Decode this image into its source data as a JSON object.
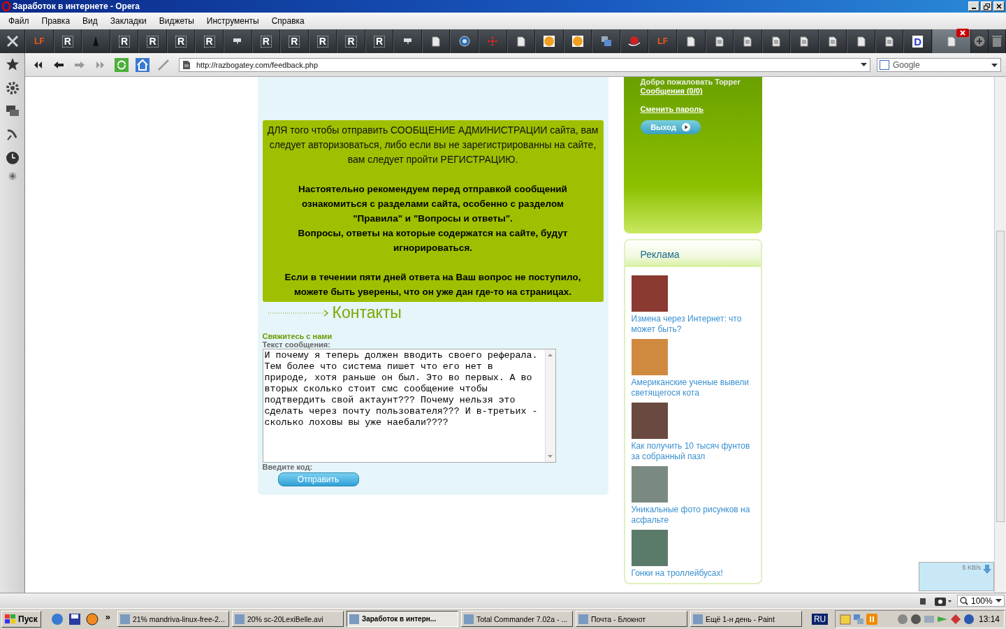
{
  "window": {
    "title": "Заработок в интернете - Opera"
  },
  "menu": [
    "Файл",
    "Правка",
    "Вид",
    "Закладки",
    "Виджеты",
    "Инструменты",
    "Справка"
  ],
  "tabs": [
    {
      "kind": "logo",
      "label": "LF",
      "selected": false
    },
    {
      "kind": "letter",
      "label": "R",
      "selected": false
    },
    {
      "kind": "dark",
      "selected": false
    },
    {
      "kind": "letter",
      "label": "R",
      "selected": false
    },
    {
      "kind": "letter",
      "label": "R",
      "selected": false
    },
    {
      "kind": "letter",
      "label": "R",
      "selected": false
    },
    {
      "kind": "letter",
      "label": "R",
      "selected": false
    },
    {
      "kind": "puzzle",
      "selected": false
    },
    {
      "kind": "letter",
      "label": "R",
      "selected": false
    },
    {
      "kind": "letter",
      "label": "R",
      "selected": false
    },
    {
      "kind": "letter",
      "label": "R",
      "selected": false
    },
    {
      "kind": "letter",
      "label": "R",
      "selected": false
    },
    {
      "kind": "letter",
      "label": "R",
      "selected": false
    },
    {
      "kind": "puzzle",
      "selected": false
    },
    {
      "kind": "doc",
      "selected": false
    },
    {
      "kind": "circle",
      "selected": false
    },
    {
      "kind": "burst",
      "selected": false
    },
    {
      "kind": "doc",
      "selected": false
    },
    {
      "kind": "orange",
      "selected": false
    },
    {
      "kind": "orange",
      "selected": false
    },
    {
      "kind": "windows",
      "selected": false
    },
    {
      "kind": "globe",
      "selected": false
    },
    {
      "kind": "logo",
      "label": "LF",
      "selected": false
    },
    {
      "kind": "doc",
      "selected": false
    },
    {
      "kind": "lines",
      "selected": false
    },
    {
      "kind": "lines",
      "selected": false
    },
    {
      "kind": "lines",
      "selected": false
    },
    {
      "kind": "lines",
      "selected": false
    },
    {
      "kind": "lines",
      "selected": false
    },
    {
      "kind": "doc",
      "selected": false
    },
    {
      "kind": "lines",
      "selected": false
    },
    {
      "kind": "badge",
      "label": "D",
      "selected": false
    },
    {
      "kind": "doc",
      "selected": true
    }
  ],
  "address_bar": {
    "url": "http://razbogatey.com/feedback.php"
  },
  "search": {
    "placeholder": "Google"
  },
  "notice": [
    {
      "kind": "plain",
      "paragraphs": [
        "ДЛЯ того чтобы отправить СООБЩЕНИЕ АДМИНИСТРАЦИИ сайта, вам следует авторизоваться, либо если вы не зарегистрированны на сайте, вам следует пройти РЕГИСТРАЦИЮ."
      ]
    },
    {
      "kind": "bold",
      "paragraphs": [
        "Настоятельно рекомендуем перед отправкой сообщений ознакомиться с разделами сайта, особенно с разделом \"Правила\" и \"Вопросы и ответы\".",
        "Вопросы, ответы на которые содержатся на сайте, будут игнорироваться."
      ]
    },
    {
      "kind": "bold",
      "paragraphs": [
        "Если в течении пяти дней ответа на Ваш вопрос не поступило, можете быть уверены, что он уже дан где-то на страницах."
      ]
    }
  ],
  "contacts": {
    "heading": "Контакты",
    "subheading": "Свяжитесь с нами",
    "message_label": "Текст сообщения:",
    "message": "И почему я теперь должен вводить своего реферала. Тем более что система пишет что его нет в природе, хотя раньше он был. Это во первых. А во вторых сколько стоит смс сообщение чтобы подтвердить свой актаунт??? Почему нельзя это сделать через почту пользователя??? И в-третьих - сколько лоховы вы уже наебали????",
    "code_label": "Введите код:",
    "submit": "Отправить"
  },
  "user_panel": {
    "welcome": "Добро пожаловать Topper",
    "messages_link": "Сообщения (0/0)",
    "change_password_link": "Сменить пароль",
    "logout": "Выход"
  },
  "ads": {
    "heading": "Реклама",
    "items": [
      {
        "title": "Измена через Интернет: что может быть?"
      },
      {
        "title": "Американские ученые вывели светящегося кота"
      },
      {
        "title": "Как получить 10 тысяч фунтов за собранный пазл"
      },
      {
        "title": "Уникальные фото рисунков на асфальте"
      },
      {
        "title": "Гонки на троллейбусах!"
      }
    ]
  },
  "transfer": {
    "speed": "5 KB/s"
  },
  "status_bar": {
    "zoom": "100%"
  },
  "taskbar": {
    "start": "Пуск",
    "more": "»",
    "tasks": [
      {
        "label": "21% mandriva-linux-free-2...",
        "selected": false
      },
      {
        "label": "20% sc-20LexiBelle.avi",
        "selected": false
      },
      {
        "label": "Заработок в интерн...",
        "selected": true
      },
      {
        "label": "Total Commander 7.02a - ...",
        "selected": false
      },
      {
        "label": "Почта - Блокнот",
        "selected": false
      },
      {
        "label": "Ещё 1-н день - Paint",
        "selected": false
      }
    ],
    "language": "RU",
    "clock": "13:14"
  }
}
